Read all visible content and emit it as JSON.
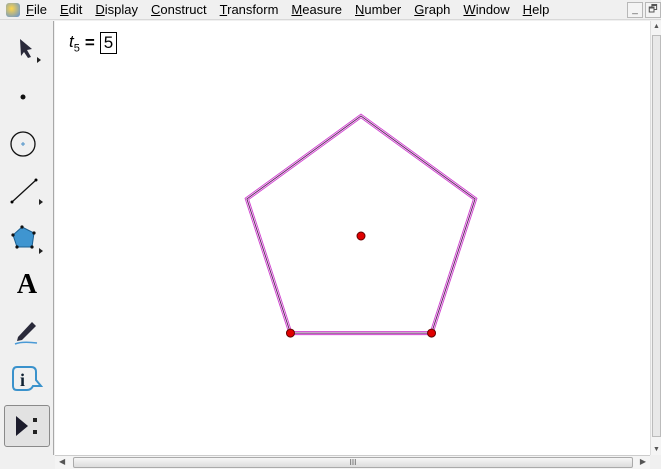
{
  "menubar": {
    "items": [
      "File",
      "Edit",
      "Display",
      "Construct",
      "Transform",
      "Measure",
      "Number",
      "Graph",
      "Window",
      "Help"
    ]
  },
  "window_buttons": {
    "minimize": "_",
    "restore": "🗗"
  },
  "toolbox": {
    "tools": [
      "arrow-select-tool",
      "point-tool",
      "compass-tool",
      "straightedge-tool",
      "polygon-tool",
      "text-tool",
      "marker-tool",
      "information-tool",
      "custom-tools"
    ],
    "text_tool_glyph": "A",
    "info_glyph": "i"
  },
  "parameter": {
    "name": "t",
    "subscript": "5",
    "equals": "=",
    "value": "5"
  },
  "sketch": {
    "shape": "regular pentagon",
    "sides": 5,
    "stroke_color": "#d040d0",
    "point_color": "#e00000"
  },
  "scrollbar": {
    "grip": "III"
  }
}
